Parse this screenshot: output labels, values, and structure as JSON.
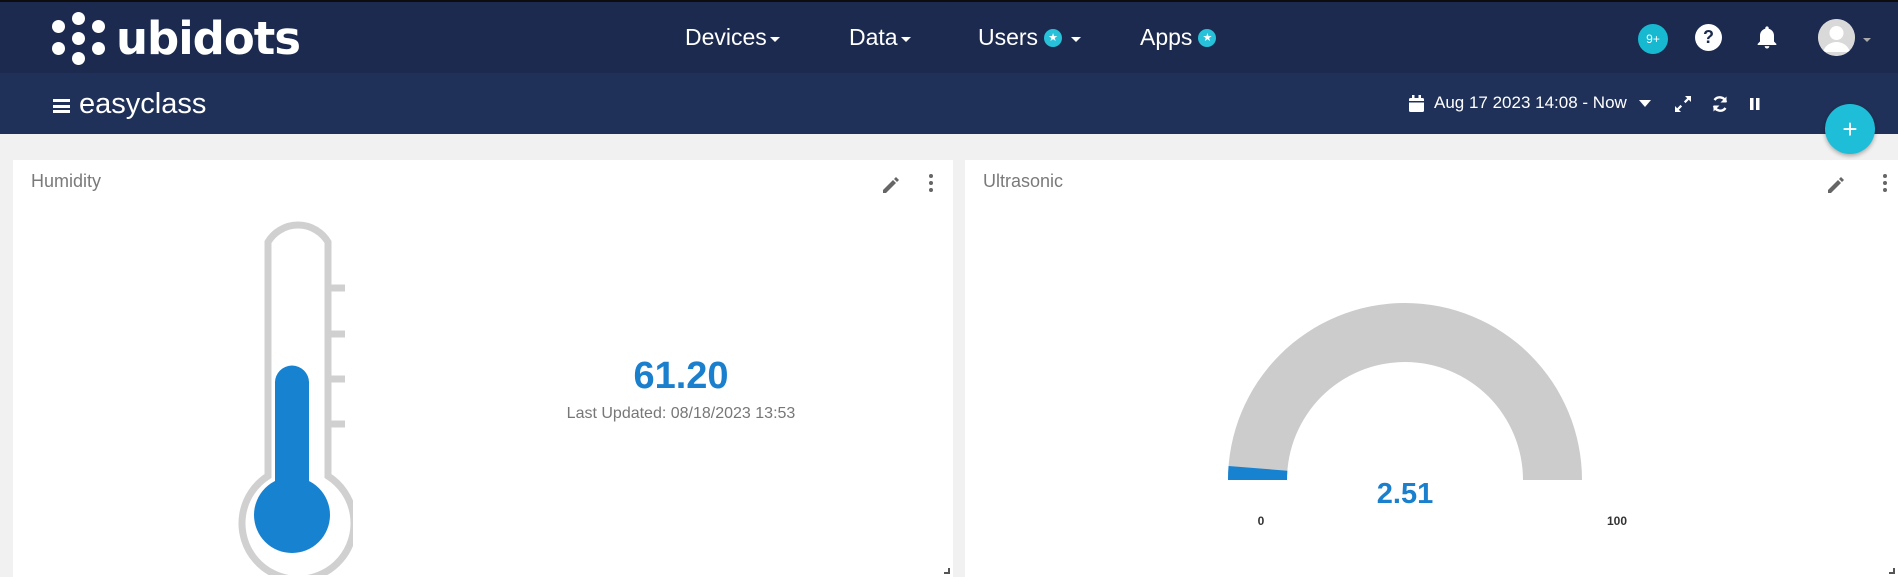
{
  "app": {
    "logo_text": "ubidots"
  },
  "nav": {
    "devices": "Devices",
    "data": "Data",
    "users": "Users",
    "apps": "Apps",
    "notification_count": "9+",
    "help": "?"
  },
  "dashboard": {
    "title": "easyclass",
    "date_range": "Aug 17 2023 14:08 - Now",
    "add_label": "+"
  },
  "widgets": {
    "humidity": {
      "title": "Humidity",
      "value": "61.20",
      "last_updated": "Last Updated: 08/18/2023 13:53",
      "level_fraction": 0.61,
      "fill_color": "#1782d0"
    },
    "ultrasonic": {
      "title": "Ultrasonic",
      "value": "2.51",
      "min": "0",
      "max": "100",
      "fill_fraction": 0.0251,
      "fill_color": "#1782d0",
      "track_color": "#cccccc"
    }
  },
  "icons": {
    "menu": "hamburger-icon",
    "calendar": "calendar-icon",
    "expand": "expand-icon",
    "refresh": "refresh-icon",
    "pause": "pause-icon",
    "bell": "bell-icon",
    "help": "help-icon",
    "avatar": "user-avatar-icon",
    "edit": "pencil-icon",
    "more": "kebab-menu-icon",
    "resize": "resize-handle-icon"
  },
  "colors": {
    "navbar": "#1b2a4e",
    "subbar": "#1f3158",
    "accent": "#1fbed8",
    "value": "#1a7fcd"
  }
}
